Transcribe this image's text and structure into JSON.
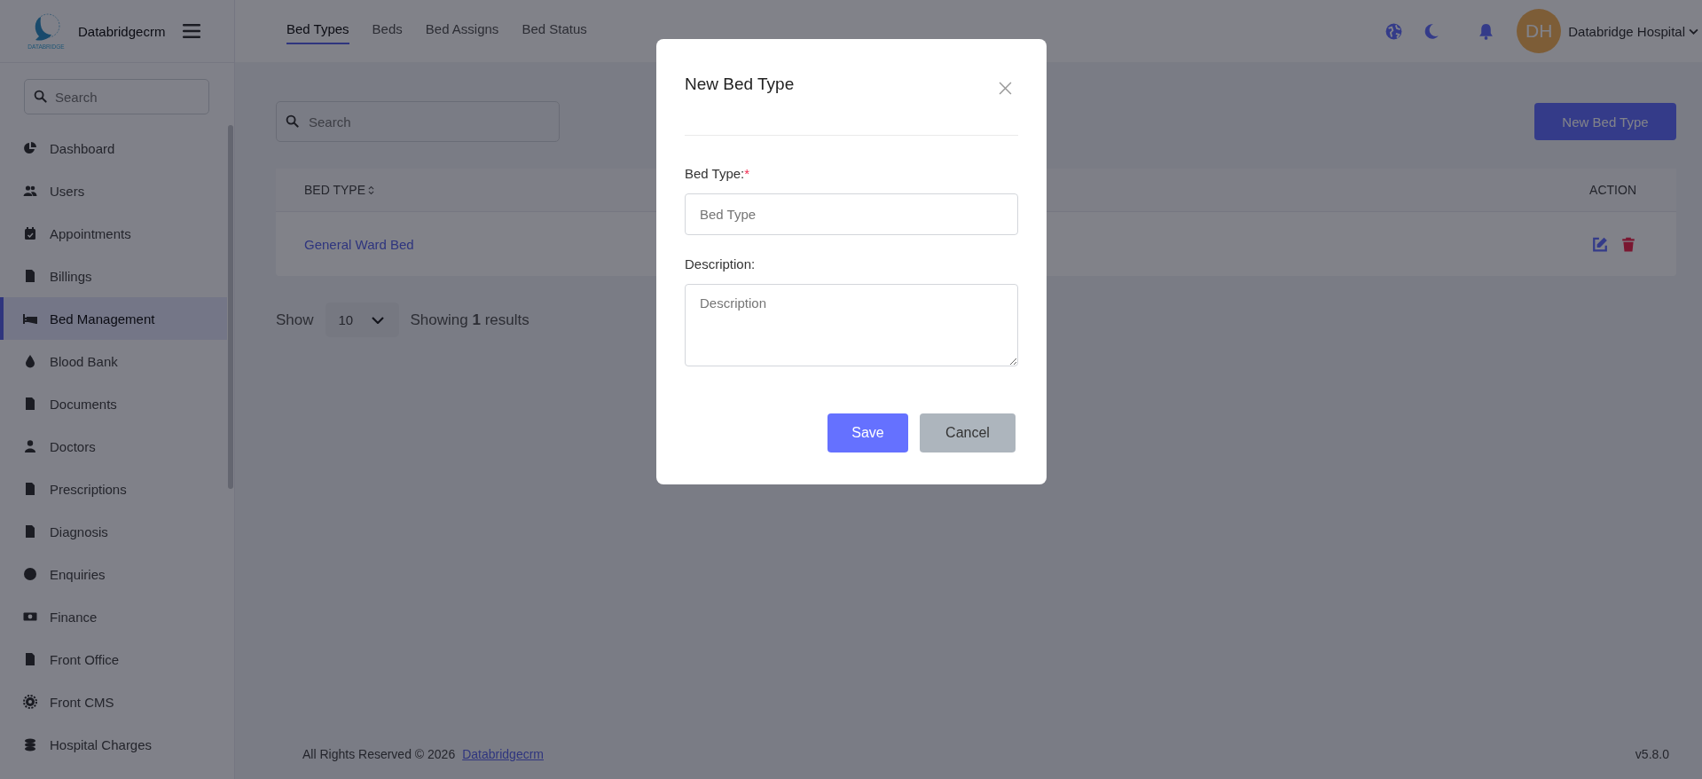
{
  "sidebar": {
    "brand": "Databridgecrm",
    "logo_text": "DATABRIDGE",
    "search": {
      "placeholder": "Search"
    },
    "items": [
      {
        "label": "Dashboard",
        "selected": false
      },
      {
        "label": "Users",
        "selected": false
      },
      {
        "label": "Appointments",
        "selected": false
      },
      {
        "label": "Billings",
        "selected": false
      },
      {
        "label": "Bed Management",
        "selected": true
      },
      {
        "label": "Blood Bank",
        "selected": false
      },
      {
        "label": "Documents",
        "selected": false
      },
      {
        "label": "Doctors",
        "selected": false
      },
      {
        "label": "Prescriptions",
        "selected": false
      },
      {
        "label": "Diagnosis",
        "selected": false
      },
      {
        "label": "Enquiries",
        "selected": false
      },
      {
        "label": "Finance",
        "selected": false
      },
      {
        "label": "Front Office",
        "selected": false
      },
      {
        "label": "Front CMS",
        "selected": false
      },
      {
        "label": "Hospital Charges",
        "selected": false
      }
    ]
  },
  "topbar": {
    "tabs": [
      {
        "label": "Bed Types",
        "selected": true
      },
      {
        "label": "Beds",
        "selected": false
      },
      {
        "label": "Bed Assigns",
        "selected": false
      },
      {
        "label": "Bed Status",
        "selected": false
      }
    ],
    "user": {
      "initials": "DH",
      "name": "Databridge Hospital"
    }
  },
  "page": {
    "search": {
      "placeholder": "Search"
    },
    "new_button": "New Bed Type",
    "table": {
      "columns": [
        "BED TYPE",
        "ACTION"
      ],
      "rows": [
        {
          "bed_type": "General Ward Bed"
        }
      ]
    },
    "pagination": {
      "show_label": "Show",
      "page_size": "10",
      "summary": "Showing **1** results"
    }
  },
  "footer": {
    "text": "All Rights Reserved © 2026",
    "link": "Databridgecrm",
    "version": "v5.8.0"
  },
  "modal": {
    "title": "New Bed Type",
    "fields": [
      {
        "kind": "input",
        "label": "Bed Type:",
        "required_mark": "*",
        "placeholder": "Bed Type"
      },
      {
        "kind": "textarea",
        "label": "Description:",
        "placeholder": "Description"
      }
    ],
    "buttons": [
      {
        "kind": "primary",
        "label": "Save"
      },
      {
        "kind": "secondary",
        "label": "Cancel"
      }
    ]
  }
}
